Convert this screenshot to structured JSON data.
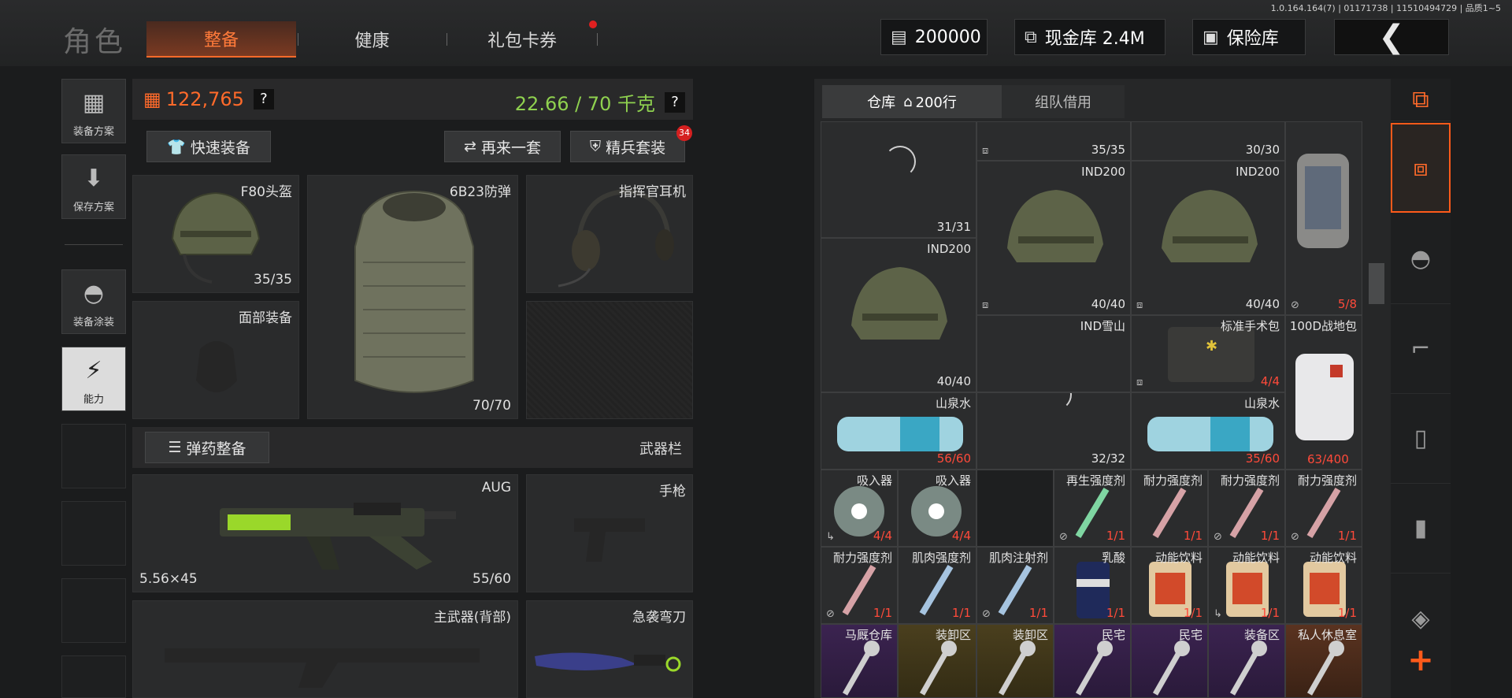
{
  "version": "1.0.164.164(7) | 01171738 | 11510494729 | 品质1~5",
  "header": {
    "role_title": "角色",
    "tabs": [
      {
        "label": "整备",
        "active": true
      },
      {
        "label": "健康",
        "active": false
      },
      {
        "label": "礼包卡券",
        "active": false
      }
    ],
    "cash": "200000",
    "vault": "现金库 2.4M",
    "safe": "保险库"
  },
  "sidebar": {
    "items": [
      {
        "label": "装备方案"
      },
      {
        "label": "保存方案"
      },
      {
        "label": "装备涂装"
      },
      {
        "label": "能力"
      }
    ]
  },
  "stats": {
    "money": "122,765",
    "weight": "22.66 / 70 千克",
    "money_color": "#ff6a2a",
    "weight_color": "#8fd14f"
  },
  "actions": {
    "quick_equip": "快速装备",
    "again": "再来一套",
    "elite": "精兵套装",
    "elite_badge": "34",
    "ammo_equip": "弹药整备",
    "weapon_bar": "武器栏"
  },
  "gear": {
    "helmet": {
      "name": "F80头盔",
      "dura": "35/35"
    },
    "armor": {
      "name": "6B23防弹",
      "dura": "70/70"
    },
    "headset": {
      "name": "指挥官耳机"
    },
    "face": {
      "name": "面部装备"
    },
    "primary": {
      "name": "AUG",
      "caliber": "5.56×45",
      "ammo": "55/60"
    },
    "pistol": {
      "name": "手枪"
    },
    "back_weapon": {
      "name": "主武器(背部)"
    },
    "knife": {
      "name": "急袭弯刀"
    }
  },
  "warehouse": {
    "tab_storage": "仓库",
    "tab_rows": "200行",
    "tab_team": "组队借用",
    "cells": [
      {
        "name": "",
        "qty": "31/31"
      },
      {
        "name": "",
        "qty": "35/35"
      },
      {
        "name": "",
        "qty": "30/30"
      },
      {
        "name": "IND200",
        "qty": "40/40"
      },
      {
        "name": "IND200",
        "qty": "40/40"
      },
      {
        "name": "",
        "qty": "5/8"
      },
      {
        "name": "IND200",
        "qty": "40/40"
      },
      {
        "name": "IND雪山",
        "qty": ""
      },
      {
        "name": "标准手术包",
        "qty": "4/4"
      },
      {
        "name": "100D战地包",
        "qty": ""
      },
      {
        "name": "山泉水",
        "qty": "56/60"
      },
      {
        "name": "",
        "qty": "32/32"
      },
      {
        "name": "山泉水",
        "qty": "35/60"
      },
      {
        "name": "",
        "qty": "63/400"
      },
      {
        "name": "吸入器",
        "qty": "4/4"
      },
      {
        "name": "吸入器",
        "qty": "4/4"
      },
      {
        "name": "再生强度剂",
        "qty": "1/1"
      },
      {
        "name": "耐力强度剂",
        "qty": "1/1"
      },
      {
        "name": "耐力强度剂",
        "qty": "1/1"
      },
      {
        "name": "耐力强度剂",
        "qty": "1/1"
      },
      {
        "name": "耐力强度剂",
        "qty": "1/1"
      },
      {
        "name": "肌肉强度剂",
        "qty": "1/1"
      },
      {
        "name": "肌肉注射剂",
        "qty": "1/1"
      },
      {
        "name": "乳酸",
        "qty": "1/1"
      },
      {
        "name": "动能饮料",
        "qty": "1/1"
      },
      {
        "name": "动能饮料",
        "qty": "1/1"
      },
      {
        "name": "动能饮料",
        "qty": "1/1"
      },
      {
        "name": "马厩仓库",
        "qty": ""
      },
      {
        "name": "装卸区",
        "qty": ""
      },
      {
        "name": "装卸区",
        "qty": ""
      },
      {
        "name": "民宅",
        "qty": ""
      },
      {
        "name": "民宅",
        "qty": ""
      },
      {
        "name": "装备区",
        "qty": ""
      },
      {
        "name": "私人休息室",
        "qty": ""
      }
    ]
  },
  "colors": {
    "accent": "#ff6a2a",
    "alert": "#ff4a3a"
  }
}
